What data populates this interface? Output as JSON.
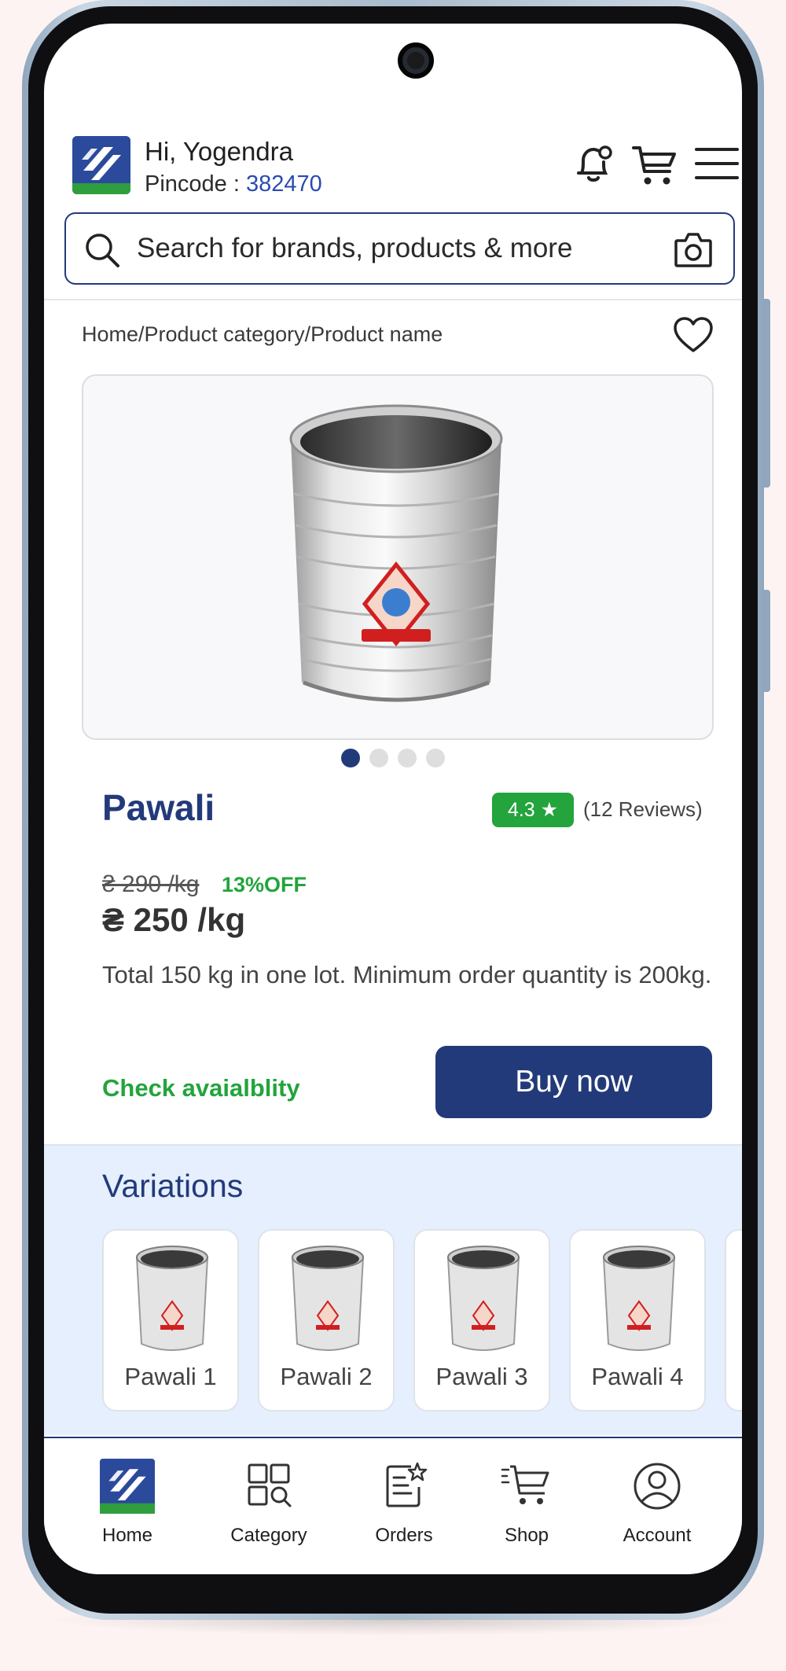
{
  "header": {
    "greeting": "Hi, Yogendra",
    "pincode_label": "Pincode : ",
    "pincode_value": "382470",
    "icons": [
      "bell-icon",
      "cart-icon",
      "menu-icon"
    ]
  },
  "search": {
    "placeholder": "Search for brands, products & more",
    "icons": [
      "search-icon",
      "camera-icon"
    ]
  },
  "breadcrumb": "Home/Product category/Product name",
  "product": {
    "name": "Pawali",
    "rating": "4.3 ★",
    "reviews": "(12 Reviews)",
    "old_price": "₴ 290 /kg",
    "discount": "13%OFF",
    "price": "₴ 250 /kg",
    "description": "Total 150 kg in one lot. Minimum order quantity is 200kg.",
    "check_availability": "Check avaialblity",
    "buy_now": "Buy now",
    "carousel": {
      "total": 4,
      "active": 1
    }
  },
  "variations": {
    "title": "Variations",
    "items": [
      {
        "label": "Pawali 1"
      },
      {
        "label": "Pawali 2"
      },
      {
        "label": "Pawali 3"
      },
      {
        "label": "Pawali 4"
      }
    ]
  },
  "bottom_nav": {
    "items": [
      {
        "label": "Home",
        "icon": "home-logo-icon"
      },
      {
        "label": "Category",
        "icon": "category-icon"
      },
      {
        "label": "Orders",
        "icon": "orders-icon"
      },
      {
        "label": "Shop",
        "icon": "shop-cart-icon"
      },
      {
        "label": "Account",
        "icon": "account-icon"
      }
    ]
  },
  "colors": {
    "brand_navy": "#233a7a",
    "accent_green": "#23a43c",
    "variations_bg": "#e6effd"
  }
}
